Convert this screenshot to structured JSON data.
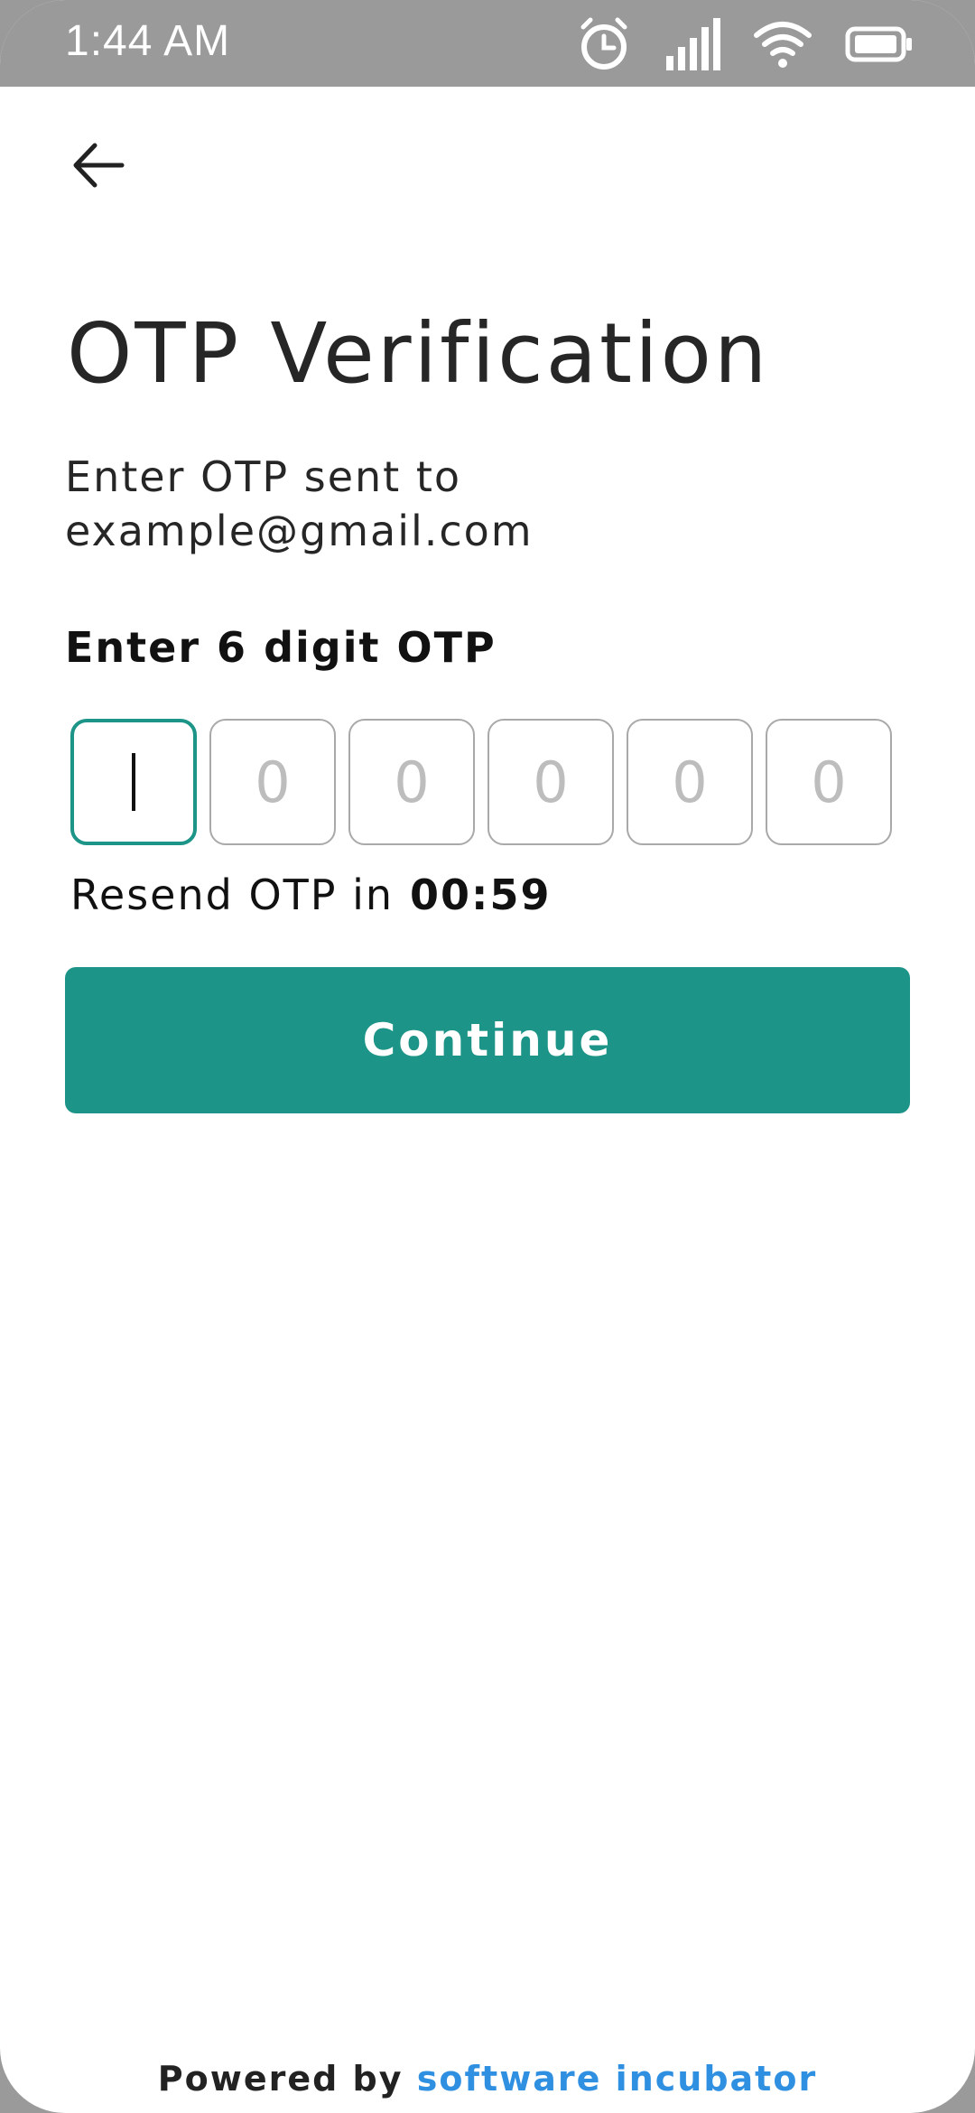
{
  "status_bar": {
    "time": "1:44 AM",
    "icons": [
      "alarm-icon",
      "signal-icon",
      "wifi-icon",
      "battery-icon"
    ]
  },
  "header": {
    "back_icon": "arrow-left-icon"
  },
  "main": {
    "title": "OTP Verification",
    "subtitle_line1": "Enter OTP sent to",
    "subtitle_line2": "example@gmail.com",
    "otp_label": "Enter 6 digit OTP",
    "otp_digits": [
      "",
      "0",
      "0",
      "0",
      "0",
      "0"
    ],
    "resend_text": "Resend OTP in",
    "resend_timer": "00:59",
    "continue_label": "Continue"
  },
  "footer": {
    "prefix": "Powered by",
    "brand": "software incubator"
  },
  "colors": {
    "accent": "#1c9487",
    "brand_link": "#2f8fe0",
    "status_bar": "#9a9a9a"
  }
}
